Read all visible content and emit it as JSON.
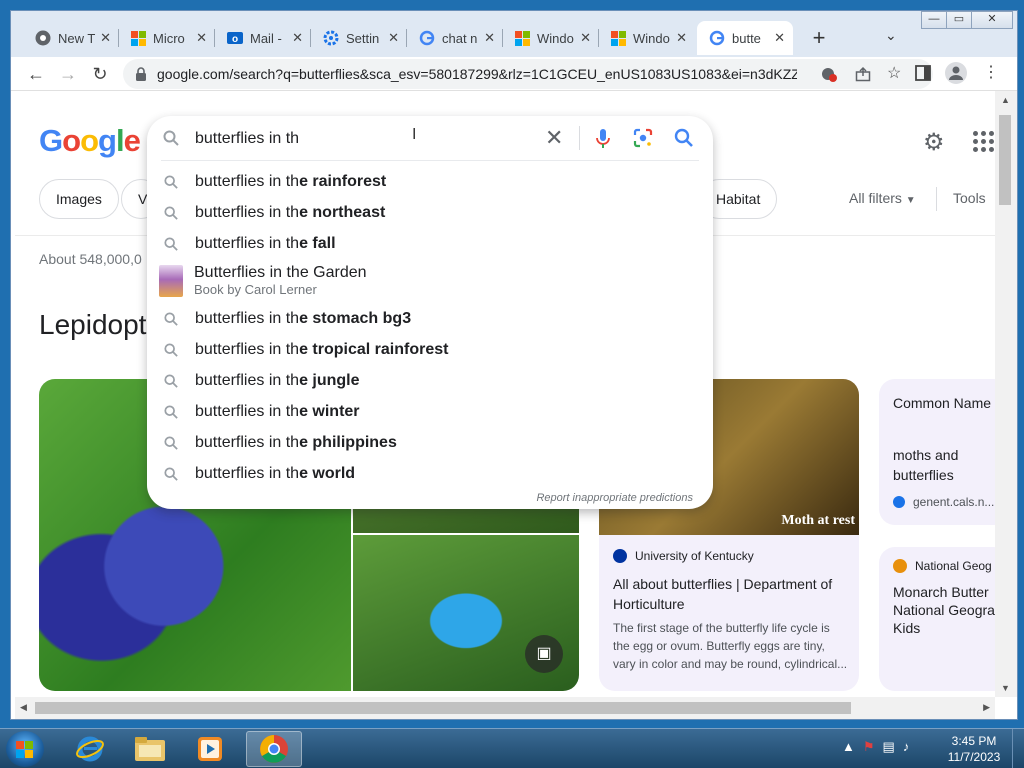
{
  "browser": {
    "tabs": [
      {
        "title": "New T",
        "icon": "chrome-icon"
      },
      {
        "title": "Micro",
        "icon": "microsoft-icon"
      },
      {
        "title": "Mail -",
        "icon": "outlook-icon"
      },
      {
        "title": "Settin",
        "icon": "gear-icon"
      },
      {
        "title": "chat n",
        "icon": "google-icon"
      },
      {
        "title": "Windo",
        "icon": "microsoft-icon"
      },
      {
        "title": "Windo",
        "icon": "microsoft-icon"
      },
      {
        "title": "butte",
        "icon": "google-icon",
        "active": true
      }
    ],
    "url": "google.com/search?q=butterflies&sca_esv=580187299&rlz=1C1GCEU_enUS1083US1083&ei=n3dKZZz..."
  },
  "google": {
    "logo": "Google",
    "chips": {
      "images": "Images",
      "videos": "Vi",
      "habitat": "Habitat"
    },
    "all_filters": "All filters",
    "tools": "Tools",
    "results_count": "About 548,000,0",
    "heading": "Lepidopt"
  },
  "search": {
    "query": "butterflies in th",
    "suggestions": [
      {
        "prefix": "butterflies in th",
        "bold": "e rainforest"
      },
      {
        "prefix": "butterflies in th",
        "bold": "e northeast"
      },
      {
        "prefix": "butterflies in th",
        "bold": "e fall"
      },
      {
        "title": "Butterflies in the Garden",
        "subtitle": "Book by Carol Lerner"
      },
      {
        "prefix": "butterflies in th",
        "bold": "e stomach bg3"
      },
      {
        "prefix": "butterflies in th",
        "bold": "e tropical rainforest"
      },
      {
        "prefix": "butterflies in th",
        "bold": "e jungle"
      },
      {
        "prefix": "butterflies in th",
        "bold": "e winter"
      },
      {
        "prefix": "butterflies in th",
        "bold": "e philippines"
      },
      {
        "prefix": "butterflies in th",
        "bold": "e world"
      }
    ],
    "report": "Report inappropriate predictions"
  },
  "cards": {
    "moth_caption": "Moth at rest",
    "uk_source": "University of Kentucky",
    "uk_title": "All about butterflies | Department of Horticulture",
    "uk_desc": "The first stage of the butterfly life cycle is the egg or ovum. Butterfly eggs are tiny, vary in color and may be round, cylindrical...",
    "common_name_label": "Common Name",
    "common_name_value": "moths and butterflies",
    "genent_source": "genent.cals.n...",
    "natgeo_source": "National Geog",
    "natgeo_title": "Monarch Butter National Geogra Kids"
  },
  "taskbar": {
    "time": "3:45 PM",
    "date": "11/7/2023"
  },
  "colors": {
    "google_blue": "#4285f4",
    "accent_red": "#ea4335",
    "card_bg": "#f3f0fb"
  }
}
